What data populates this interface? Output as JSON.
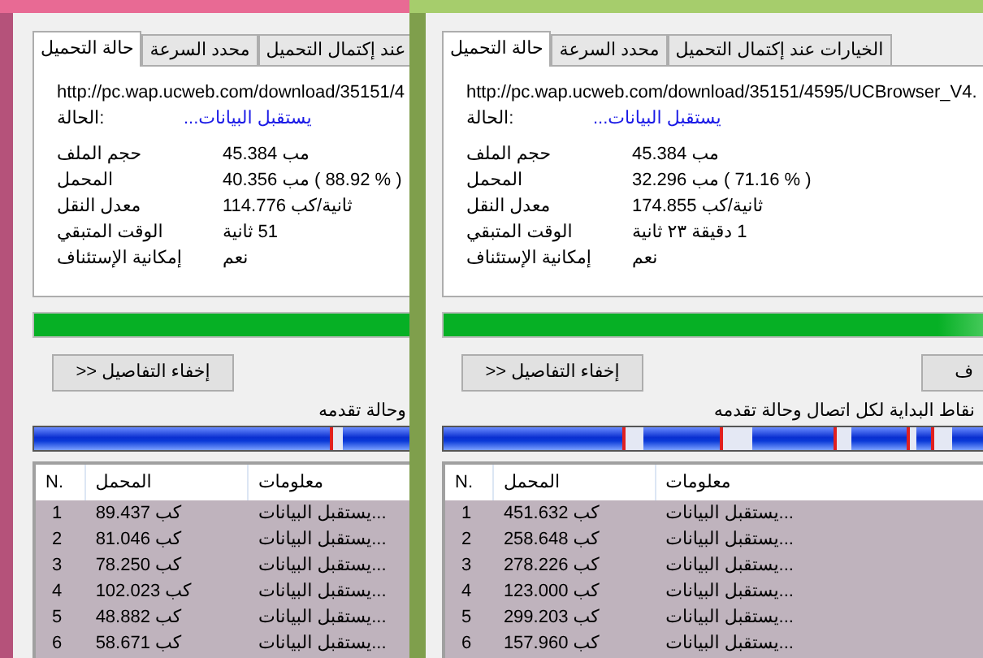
{
  "windows": [
    {
      "tabs": [
        {
          "label": "الخيارات عند إكتمال التحميل",
          "selected": false
        },
        {
          "label": "محدد السرعة",
          "selected": false
        },
        {
          "label": "حالة التحميل",
          "selected": true
        }
      ],
      "url": "http://pc.wap.ucweb.com/download/35151/4595/UCBrowser_V4.",
      "status": {
        "label": "الحالة:",
        "value": "يستقبل البيانات..."
      },
      "details": [
        {
          "label": "حجم الملف",
          "value": "مب 45.384"
        },
        {
          "label": "المحمل",
          "value": "( % 71.16 ) مب 32.296"
        },
        {
          "label": "معدل النقل",
          "value": "ثانية/كب 174.855"
        },
        {
          "label": "الوقت المتبقي",
          "value": "1 دقيقة ٢٣ ثانية"
        },
        {
          "label": "إمكانية الإستئناف",
          "value": "نعم"
        }
      ],
      "progress": {
        "level": 1
      },
      "buttons": [
        "ف",
        "إخفاء التفاصيل <<"
      ],
      "connections_label": "نقاط البداية لكل اتصال وحالة تقدمه",
      "table": {
        "columns": [
          "معلومات",
          "المحمل",
          "N."
        ],
        "rows": [
          [
            "يستقبل البيانات...",
            "451.632 كب",
            "1"
          ],
          [
            "يستقبل البيانات...",
            "258.648 كب",
            "2"
          ],
          [
            "يستقبل البيانات...",
            "278.226 كب",
            "3"
          ],
          [
            "يستقبل البيانات...",
            "123.000 كب",
            "4"
          ],
          [
            "يستقبل البيانات...",
            "299.203 كب",
            "5"
          ],
          [
            "يستقبل البيانات...",
            "157.960 كب",
            "6"
          ]
        ]
      }
    },
    {
      "tabs": [
        {
          "label": "عند إكتمال التحميل",
          "selected": false
        },
        {
          "label": "محدد السرعة",
          "selected": false
        },
        {
          "label": "حالة التحميل",
          "selected": true
        }
      ],
      "url": "http://pc.wap.ucweb.com/download/35151/4",
      "status": {
        "label": "الحالة:",
        "value": "يستقبل البيانات..."
      },
      "details": [
        {
          "label": "حجم الملف",
          "value": "مب 45.384"
        },
        {
          "label": "المحمل",
          "value": "( % 88.92 ) مب 40.356"
        },
        {
          "label": "معدل النقل",
          "value": "ثانية/كب 114.776"
        },
        {
          "label": "الوقت المتبقي",
          "value": "51 ثانية"
        },
        {
          "label": "إمكانية الإستئناف",
          "value": "نعم"
        }
      ],
      "progress": {
        "level": 1
      },
      "buttons": [
        "إخفاء التفاصيل <<"
      ],
      "connections_label": "وحالة تقدمه",
      "table": {
        "columns": [
          "معلومات",
          "المحمل",
          "N."
        ],
        "rows": [
          [
            "يستقبل البيانات...",
            "89.437 كب",
            "1"
          ],
          [
            "يستقبل البيانات...",
            "81.046 كب",
            "2"
          ],
          [
            "يستقبل البيانات...",
            "78.250 كب",
            "3"
          ],
          [
            "يستقبل البيانات...",
            "102.023 كب",
            "4"
          ],
          [
            "يستقبل البيانات...",
            "48.882 كب",
            "5"
          ],
          [
            "يستقبل البيانات...",
            "58.671 كب",
            "6"
          ]
        ]
      }
    }
  ]
}
